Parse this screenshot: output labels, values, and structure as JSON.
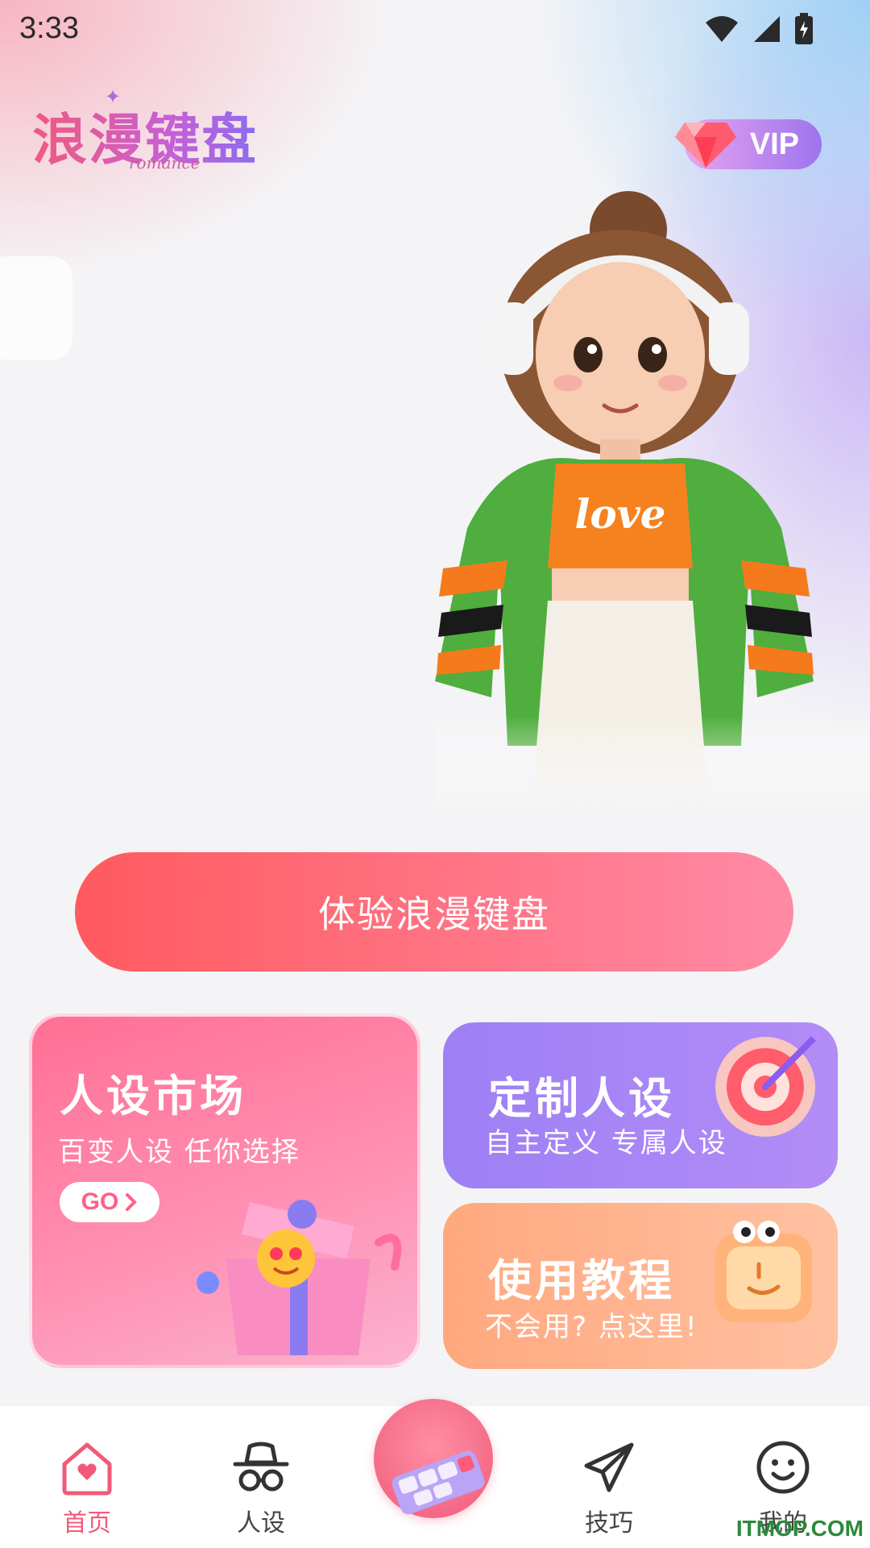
{
  "status_bar": {
    "time": "3:33"
  },
  "header": {
    "logo_text": "浪漫键盘",
    "logo_subtext": "romance",
    "vip_label": "VIP"
  },
  "hero": {
    "shirt_text": "love"
  },
  "cta": {
    "label": "体验浪漫键盘"
  },
  "cards": {
    "market": {
      "title": "人设市场",
      "subtitle": "百变人设 任你选择",
      "go_label": "GO"
    },
    "custom": {
      "title": "定制人设",
      "subtitle": "自主定义 专属人设"
    },
    "tutorial": {
      "title": "使用教程",
      "subtitle": "不会用? 点这里!"
    }
  },
  "nav": {
    "items": [
      {
        "label": "首页",
        "icon": "home-heart-icon",
        "active": true
      },
      {
        "label": "人设",
        "icon": "spy-hat-glasses-icon",
        "active": false
      },
      {
        "label": "",
        "icon": "love-keyboard-icon",
        "active": false
      },
      {
        "label": "技巧",
        "icon": "paper-plane-icon",
        "active": false
      },
      {
        "label": "我的",
        "icon": "smiley-face-icon",
        "active": false
      }
    ]
  },
  "watermark": "ITMOP.COM",
  "colors": {
    "accent": "#f05a78",
    "purple": "#9d80f5",
    "orange": "#ffa87e"
  }
}
